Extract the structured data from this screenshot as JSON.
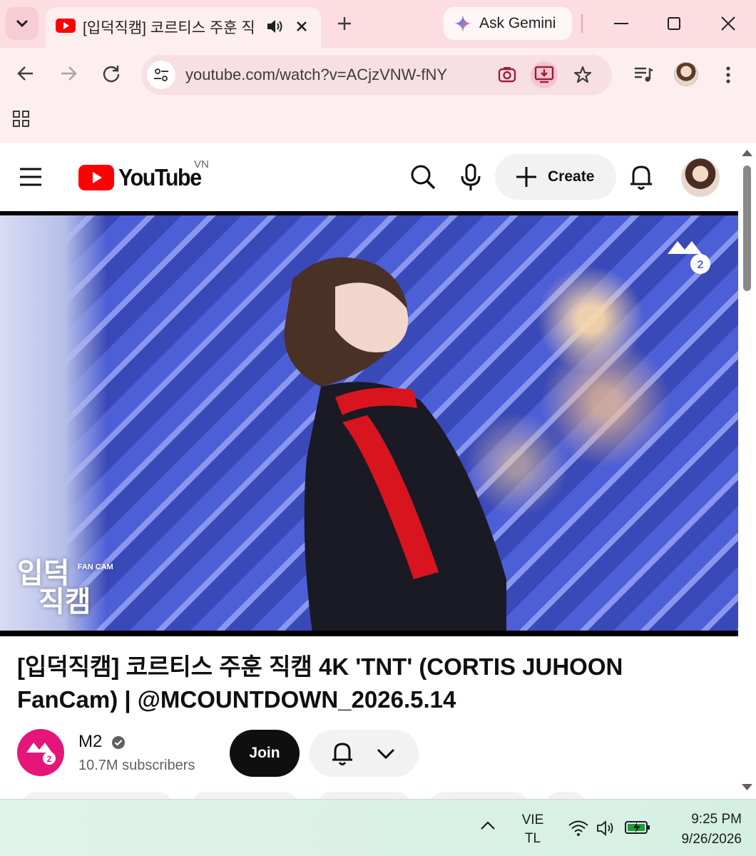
{
  "browser": {
    "tab": {
      "title": "[입덕직캠] 코르티스 주훈 직",
      "favicon": "youtube-icon",
      "audio_icon": "speaker-icon",
      "close_icon": "close-icon"
    },
    "gemini_label": "Ask Gemini",
    "url": "youtube.com/watch?v=ACjzVNW-fNY",
    "colors": {
      "tabstrip": "#fbdde2",
      "toolbar": "#fdeef0",
      "omnibox": "#f7dfe3"
    }
  },
  "youtube": {
    "logo_text": "YouTube",
    "country_code": "VN",
    "create_label": "Create",
    "video": {
      "title": "[입덕직캠] 코르티스 주훈 직캠 4K 'TNT' (CORTIS JUHOON FanCam) | @MCOUNTDOWN_2026.5.14",
      "watermark_top": "입덕",
      "watermark_bottom": "직캠",
      "watermark_tag": "FAN CAM",
      "channel_logo": "M2"
    },
    "channel": {
      "name": "M2",
      "subscribers": "10.7M subscribers",
      "join_label": "Join",
      "avatar_color": "#e5157a"
    },
    "accent_color": "#ff0000"
  },
  "taskbar": {
    "lang_top": "VIE",
    "lang_bottom": "TL",
    "time": "9:25 PM",
    "date": "9/26/2026"
  }
}
